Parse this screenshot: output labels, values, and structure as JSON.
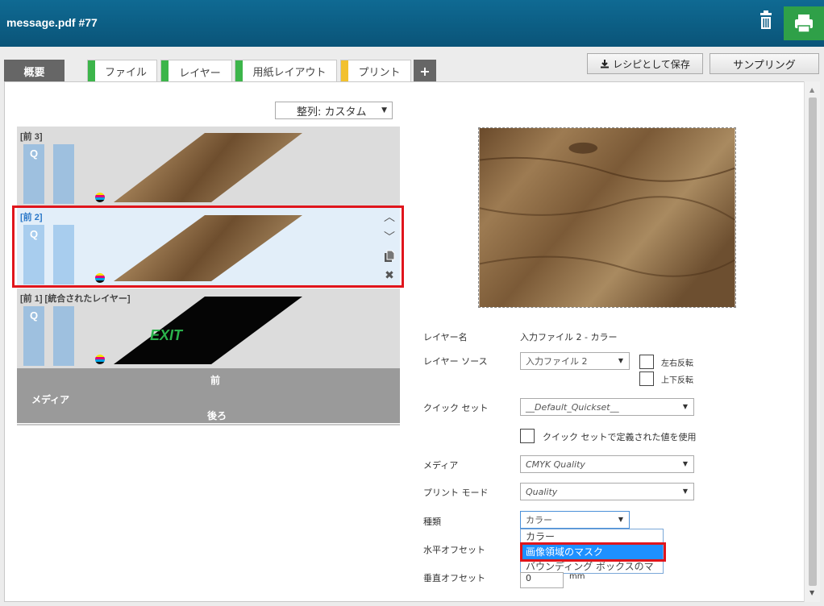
{
  "window": {
    "title": "message.pdf #77"
  },
  "tabs": [
    {
      "label": "概要"
    },
    {
      "label": "ファイル"
    },
    {
      "label": "レイヤー"
    },
    {
      "label": "用紙レイアウト"
    },
    {
      "label": "プリント"
    },
    {
      "label": "+"
    }
  ],
  "toolbar": {
    "save_recipe": "レシピとして保存",
    "sampling": "サンプリング"
  },
  "align": {
    "value": "整列: カスタム"
  },
  "layers": [
    {
      "name": "[前 3]",
      "q": "Q"
    },
    {
      "name": "[前 2]",
      "q": "Q"
    },
    {
      "name": "[前 1] [統合されたレイヤー]",
      "q": "Q",
      "text": "EXIT"
    }
  ],
  "media": {
    "front": "前",
    "media": "メディア",
    "back": "後ろ"
  },
  "form": {
    "layer_name_label": "レイヤー名",
    "layer_name_value": "入力ファイル 2 - カラー",
    "layer_source_label": "レイヤー ソース",
    "layer_source_value": "入力ファイル 2",
    "flip_h": "左右反転",
    "flip_v": "上下反転",
    "quickset_label": "クイック セット",
    "quickset_value": "__Default_Quickset__",
    "use_quickset": "クイック セットで定義された値を使用",
    "media_label": "メディア",
    "media_value": "CMYK Quality",
    "print_mode_label": "プリント モード",
    "print_mode_value": "Quality",
    "type_label": "種類",
    "type_value": "カラー",
    "type_options": [
      "カラー",
      "画像領域のマスク",
      "バウンディング ボックスのマスク"
    ],
    "h_offset_label": "水平オフセット",
    "v_offset_label": "垂直オフセット",
    "v_offset_value": "0",
    "unit": "mm"
  },
  "colors": {
    "accent_green": "#3cb54a",
    "accent_yellow": "#f2c12e",
    "title_blue": "#0f6a93",
    "highlight": "#e0151c"
  }
}
